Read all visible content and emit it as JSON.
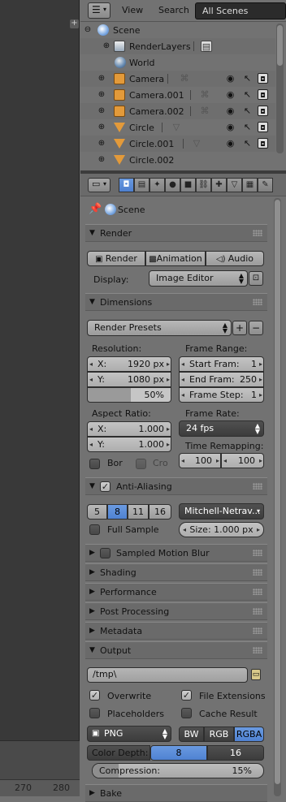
{
  "outliner": {
    "header": {
      "view": "View",
      "search": "Search",
      "scene_selector": "All Scenes"
    },
    "rows": [
      {
        "label": "Scene",
        "icon": "scene-icon",
        "expand": "⊖"
      },
      {
        "label": "RenderLayers",
        "icon": "renderlayers-icon",
        "expand": "⊕"
      },
      {
        "label": "World",
        "icon": "world-icon",
        "expand": ""
      },
      {
        "label": "Camera",
        "icon": "camera-object-icon",
        "expand": "⊕"
      },
      {
        "label": "Camera.001",
        "icon": "camera-object-icon",
        "expand": "⊕"
      },
      {
        "label": "Camera.002",
        "icon": "camera-object-icon",
        "expand": "⊕"
      },
      {
        "label": "Circle",
        "icon": "mesh-object-icon",
        "expand": "⊕"
      },
      {
        "label": "Circle.001",
        "icon": "mesh-object-icon",
        "expand": "⊕"
      },
      {
        "label": "Circle.002",
        "icon": "mesh-object-icon",
        "expand": "⊕"
      }
    ]
  },
  "viewport": {
    "ruler": [
      "270",
      "280"
    ]
  },
  "properties": {
    "context": "Scene",
    "render": {
      "title": "Render",
      "render_btn": "Render",
      "animation_btn": "Animation",
      "audio_btn": "Audio",
      "display_label": "Display:",
      "display_value": "Image Editor"
    },
    "dimensions": {
      "title": "Dimensions",
      "presets": "Render Presets",
      "resolution_label": "Resolution:",
      "res_x_label": "X:",
      "res_x": "1920 px",
      "res_y_label": "Y:",
      "res_y": "1080 px",
      "res_pct": "50%",
      "frame_range_label": "Frame Range:",
      "start_label": "Start Fram:",
      "start": "1",
      "end_label": "End Fram:",
      "end": "250",
      "step_label": "Frame Step:",
      "step": "1",
      "aspect_label": "Aspect Ratio:",
      "asp_x_label": "X:",
      "asp_x": "1.000",
      "asp_y_label": "Y:",
      "asp_y": "1.000",
      "frame_rate_label": "Frame Rate:",
      "fps": "24 fps",
      "time_remap_label": "Time Remapping:",
      "remap_old": "100",
      "remap_new": "100",
      "border_label": "Bor",
      "crop_label": "Cro"
    },
    "anti_aliasing": {
      "title": "Anti-Aliasing",
      "samples": [
        "5",
        "8",
        "11",
        "16"
      ],
      "active_sample": "8",
      "filter": "Mitchell-Netrav...",
      "full_sample": "Full Sample",
      "size": "Size: 1.000 px"
    },
    "collapsed_panels": [
      "Sampled Motion Blur",
      "Shading",
      "Performance",
      "Post Processing",
      "Metadata"
    ],
    "output": {
      "title": "Output",
      "path": "/tmp\\",
      "overwrite": "Overwrite",
      "file_ext": "File Extensions",
      "placeholders": "Placeholders",
      "cache_result": "Cache Result",
      "format": "PNG",
      "channels": [
        "BW",
        "RGB",
        "RGBA"
      ],
      "active_channel": "RGBA",
      "color_depth_label": "Color Depth:",
      "depths": [
        "8",
        "16"
      ],
      "active_depth": "8",
      "compression": "Compression:",
      "compression_value": "15%",
      "compression_fraction": 0.15
    },
    "bake": {
      "title": "Bake"
    }
  }
}
